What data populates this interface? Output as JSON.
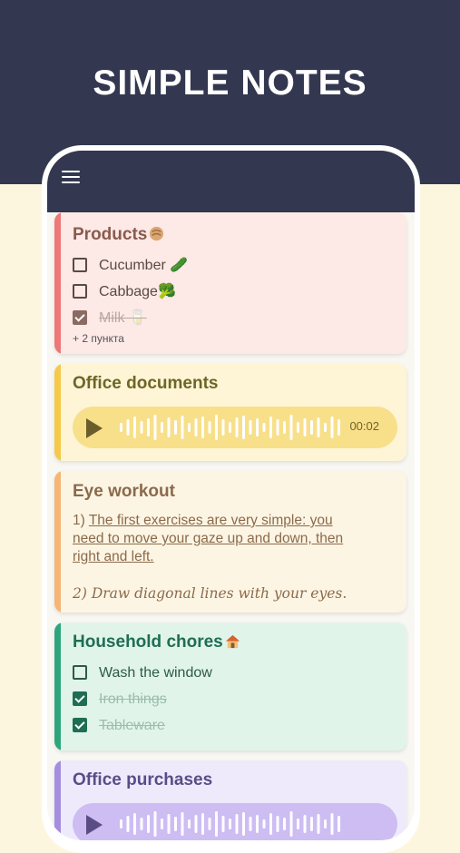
{
  "banner": {
    "title": "SIMPLE NOTES"
  },
  "colors": {
    "banner_bg": "#33374f",
    "page_bg": "#fdf6df",
    "red_card": "#fde9e5",
    "red_accent": "#ee7777",
    "yellow_card": "#fdf5d6",
    "yellow_accent": "#f5c94a",
    "orange_card": "#fdf5e4",
    "orange_accent": "#f6b574",
    "green_card": "#e1f4ea",
    "green_accent": "#2fa57e",
    "purple_card": "#eeeafc",
    "purple_accent": "#a58ee0"
  },
  "appbar": {
    "menu_icon": "hamburger-menu-icon"
  },
  "notes": {
    "products": {
      "title": "Products",
      "emoji": "bread-emoji",
      "items": [
        {
          "label": "Cucumber 🥒",
          "checked": false
        },
        {
          "label": "Cabbage🥦",
          "checked": false
        },
        {
          "label": "Milk 🥛",
          "checked": true
        }
      ],
      "more": "+ 2 пункта"
    },
    "office_documents": {
      "title": "Office documents",
      "audio": {
        "duration": "00:02",
        "icon": "play-icon"
      }
    },
    "eye_workout": {
      "title": "Eye workout",
      "line1_prefix": "1) ",
      "line1_underlined": "The first exercises are very simple: you",
      "line2": "need to move your gaze up and down, then",
      "line3": "right and left.",
      "line4": "2) Draw diagonal lines with your eyes."
    },
    "household": {
      "title": "Household chores",
      "emoji": "house-emoji",
      "items": [
        {
          "label": "Wash the window",
          "checked": false
        },
        {
          "label": "Iron things",
          "checked": true
        },
        {
          "label": "Tableware",
          "checked": true
        }
      ]
    },
    "office_purchases": {
      "title": "Office purchases"
    }
  }
}
